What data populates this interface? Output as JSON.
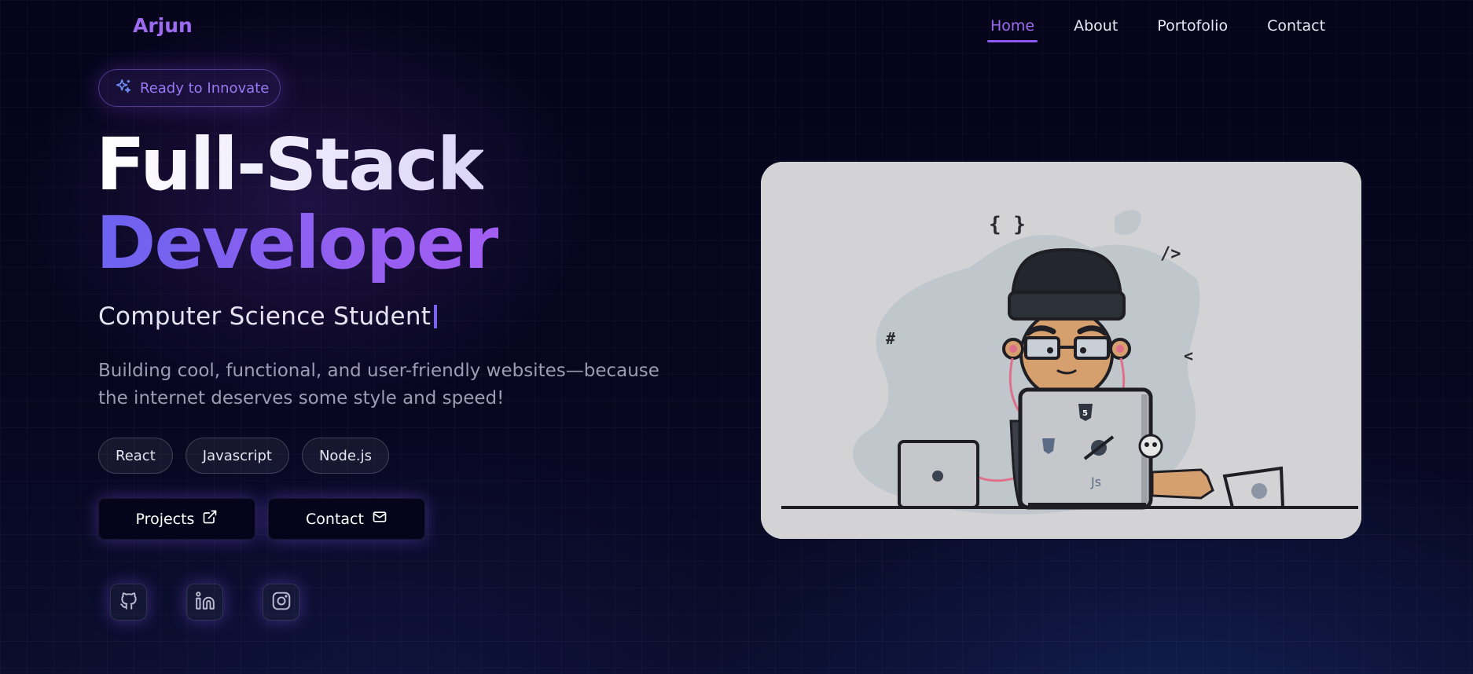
{
  "brand": "Arjun",
  "nav": {
    "items": [
      {
        "label": "Home",
        "active": true
      },
      {
        "label": "About",
        "active": false
      },
      {
        "label": "Portofolio",
        "active": false
      },
      {
        "label": "Contact",
        "active": false
      }
    ]
  },
  "hero": {
    "badge": "Ready to Innovate",
    "title_line1": "Full-Stack",
    "title_line2": "Developer",
    "role": "Computer Science Student",
    "description": "Building cool, functional, and user-friendly websites—because the internet deserves some style and speed!",
    "tags": [
      "React",
      "Javascript",
      "Node.js"
    ],
    "buttons": {
      "projects": "Projects",
      "contact": "Contact"
    }
  },
  "illustration": {
    "symbols": {
      "braces": "{ }",
      "close_tag": "/>",
      "hash": "#",
      "angle": "<",
      "js": "Js"
    }
  },
  "colors": {
    "accent": "#8d59ee",
    "brand": "#9d6af0",
    "background": "#05041a"
  },
  "icons": {
    "badge": "sparkles-icon",
    "projects": "external-link-icon",
    "contact": "mail-icon",
    "socials": [
      "github-icon",
      "linkedin-icon",
      "instagram-icon"
    ]
  }
}
